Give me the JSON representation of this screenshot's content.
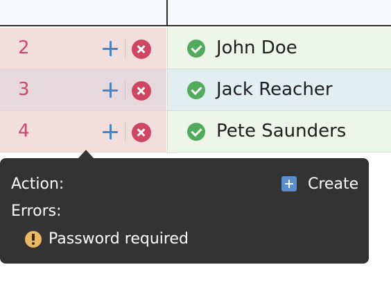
{
  "rows": [
    {
      "number": "2",
      "name": "John Doe",
      "status_icon": "check-circle-icon"
    },
    {
      "number": "3",
      "name": "Jack Reacher",
      "status_icon": "check-circle-icon"
    },
    {
      "number": "4",
      "name": "Pete Saunders",
      "status_icon": "check-circle-icon"
    }
  ],
  "row_actions": {
    "add_icon": "plus-icon",
    "delete_icon": "close-circle-icon"
  },
  "tooltip": {
    "action_label": "Action:",
    "action_value": "Create",
    "action_icon": "plus-square-icon",
    "errors_label": "Errors:",
    "errors": [
      {
        "icon": "warning-icon",
        "text": "Password required"
      }
    ]
  },
  "colors": {
    "row_number": "#c74a67",
    "delete": "#cf4660",
    "add": "#4a84c2",
    "status_ok": "#52aa5d",
    "warning": "#e9b864",
    "tooltip_bg": "#333333"
  }
}
